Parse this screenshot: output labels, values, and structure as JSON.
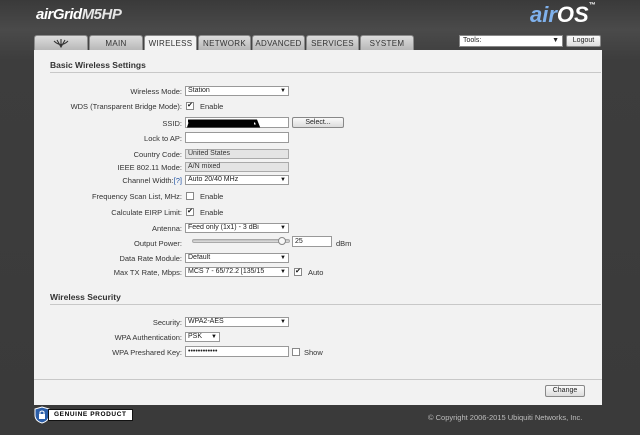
{
  "brand": {
    "product": "airGrid",
    "model": "M5HP"
  },
  "logo": {
    "air": "air",
    "os": "OS",
    "tm": "™"
  },
  "tabs": [
    {
      "label": "",
      "icon": "ubiquiti-logo-icon"
    },
    {
      "label": "MAIN"
    },
    {
      "label": "WIRELESS",
      "active": true
    },
    {
      "label": "NETWORK"
    },
    {
      "label": "ADVANCED"
    },
    {
      "label": "SERVICES"
    },
    {
      "label": "SYSTEM"
    }
  ],
  "toolbar": {
    "tools_value": "Tools:",
    "logout_label": "Logout"
  },
  "basic": {
    "title": "Basic Wireless Settings",
    "wireless_mode": {
      "label": "Wireless Mode:",
      "value": "Station"
    },
    "wds": {
      "label": "WDS (Transparent Bridge Mode):",
      "checked": true,
      "option": "Enable"
    },
    "ssid": {
      "label": "SSID:",
      "value": "",
      "select_button": "Select..."
    },
    "lock_ap": {
      "label": "Lock to AP:",
      "value": ""
    },
    "country": {
      "label": "Country Code:",
      "value": "United States"
    },
    "ieee": {
      "label": "IEEE 802.11 Mode:",
      "value": "A/N mixed"
    },
    "channel_width": {
      "label": "Channel Width:",
      "help": "[?]",
      "value": "Auto 20/40 MHz"
    },
    "freq_scan": {
      "label": "Frequency Scan List, MHz:",
      "checked": false,
      "option": "Enable"
    },
    "eirp": {
      "label": "Calculate EIRP Limit:",
      "checked": true,
      "option": "Enable"
    },
    "antenna": {
      "label": "Antenna:",
      "value": "Feed only (1x1) - 3 dBi"
    },
    "output_power": {
      "label": "Output Power:",
      "value": "25",
      "unit": "dBm",
      "level": 0.96
    },
    "data_rate": {
      "label": "Data Rate Module:",
      "value": "Default"
    },
    "max_tx": {
      "label": "Max TX Rate, Mbps:",
      "value": "MCS 7 - 65/72.2 [135/15",
      "auto_checked": true,
      "auto_label": "Auto"
    }
  },
  "security": {
    "title": "Wireless Security",
    "security": {
      "label": "Security:",
      "value": "WPA2-AES"
    },
    "wpa_auth": {
      "label": "WPA Authentication:",
      "value": "PSK"
    },
    "wpa_key": {
      "label": "WPA Preshared Key:",
      "value": "••••••••••••",
      "show_checked": false,
      "show_label": "Show"
    }
  },
  "actions": {
    "change_label": "Change"
  },
  "footer": {
    "copyright": "© Copyright 2006-2015 Ubiquiti Networks, Inc.",
    "genuine_text": "GENUINE  PRODUCT"
  },
  "colors": {
    "accent_blue": "#7fb1ec",
    "panel": "#f2f2f2",
    "background": "#3a3a3a"
  }
}
